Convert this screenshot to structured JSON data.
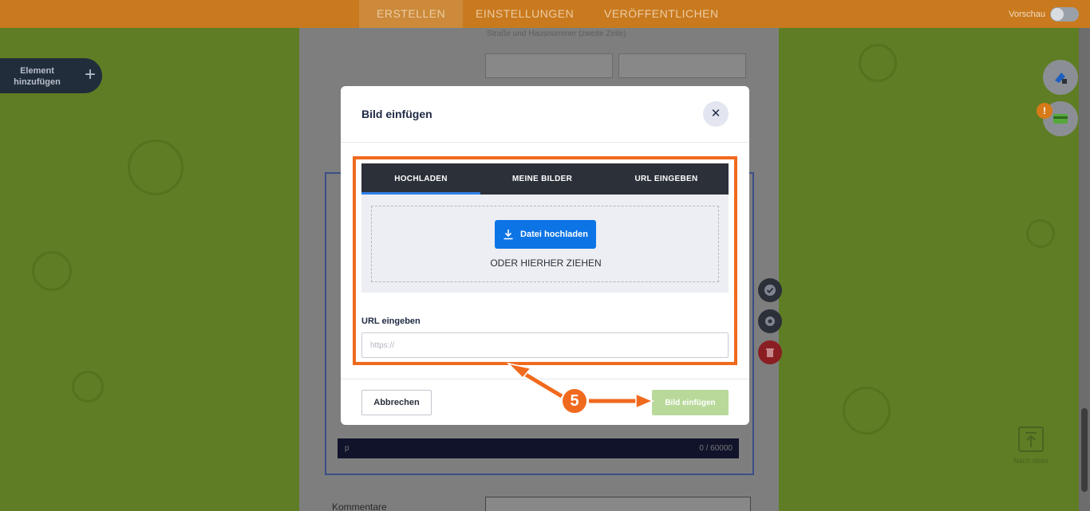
{
  "topbar": {
    "tabs": [
      {
        "label": "ERSTELLEN",
        "active": true
      },
      {
        "label": "EINSTELLUNGEN",
        "active": false
      },
      {
        "label": "VERÖFFENTLICHEN",
        "active": false
      }
    ],
    "preview_label": "Vorschau"
  },
  "sidebar": {
    "add_element_label": "Element hinzufügen"
  },
  "form": {
    "address_hint": "Straße und Hausnummer (zweite Zeile)",
    "editor_tag": "p",
    "editor_counter": "0 / 60000",
    "comment_label": "Kommentare"
  },
  "right_panel": {
    "warning_badge": "!",
    "back_to_top_label": "Nach oben"
  },
  "modal": {
    "title": "Bild einfügen",
    "tabs": [
      {
        "label": "HOCHLADEN",
        "active": true
      },
      {
        "label": "MEINE BILDER",
        "active": false
      },
      {
        "label": "URL EINGEBEN",
        "active": false
      }
    ],
    "upload_button": "Datei hochladen",
    "drag_text": "ODER HIERHER ZIEHEN",
    "url_label": "URL eingeben",
    "url_placeholder": "https://",
    "url_value": "",
    "cancel_button": "Abbrechen",
    "insert_button": "Bild einfügen"
  },
  "annotation": {
    "step_number": "5",
    "color": "#f06a1e"
  },
  "colors": {
    "topbar": "#c97a1e",
    "primary_button": "#0d74e6",
    "tab_bar": "#2c3039",
    "insert_disabled": "#b9d99a"
  }
}
